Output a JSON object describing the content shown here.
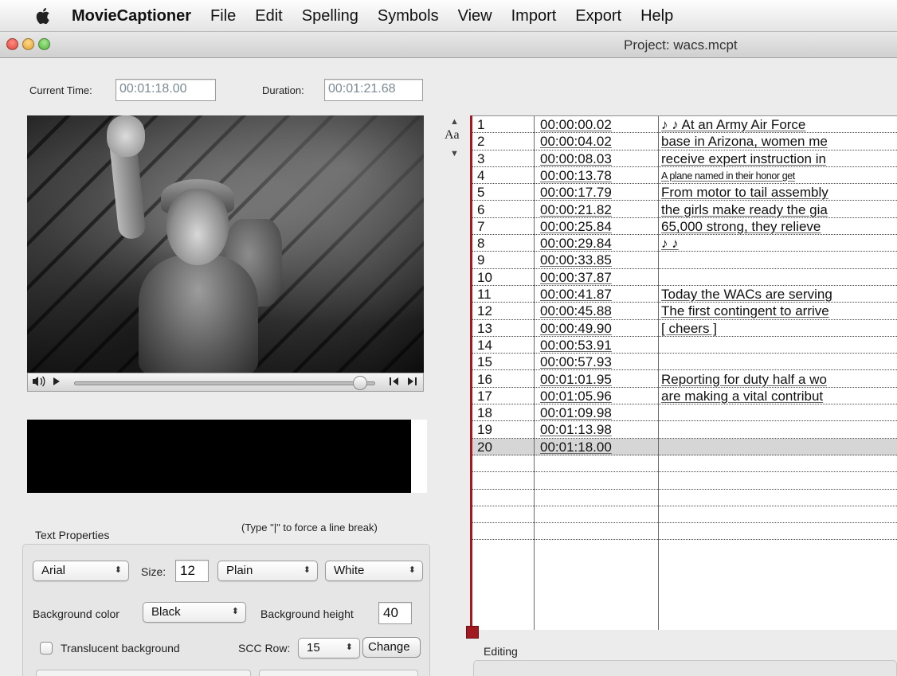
{
  "menubar": {
    "app_name": "MovieCaptioner",
    "items": [
      "File",
      "Edit",
      "Spelling",
      "Symbols",
      "View",
      "Import",
      "Export",
      "Help"
    ]
  },
  "window": {
    "title": "Project: wacs.mcpt"
  },
  "time": {
    "current_label": "Current Time:",
    "current_value": "00:01:18.00",
    "duration_label": "Duration:",
    "duration_value": "00:01:21.68"
  },
  "player": {
    "volume_icon": "speaker-icon",
    "play_icon": "play-icon",
    "position_fraction": 0.95
  },
  "sort": {
    "label": "Aa"
  },
  "captions": [
    {
      "num": "1",
      "time": "00:00:00.02",
      "text": "♪ ♪ At an Army Air Force"
    },
    {
      "num": "2",
      "time": "00:00:04.02",
      "text": "base in Arizona, women me"
    },
    {
      "num": "3",
      "time": "00:00:08.03",
      "text": "receive expert instruction in"
    },
    {
      "num": "4",
      "time": "00:00:13.78",
      "text": "A plane named in their honor get"
    },
    {
      "num": "5",
      "time": "00:00:17.79",
      "text": "From motor to tail assembly"
    },
    {
      "num": "6",
      "time": "00:00:21.82",
      "text": "the girls make ready the gia"
    },
    {
      "num": "7",
      "time": "00:00:25.84",
      "text": "65,000 strong, they relieve"
    },
    {
      "num": "8",
      "time": "00:00:29.84",
      "text": "♪ ♪"
    },
    {
      "num": "9",
      "time": "00:00:33.85",
      "text": ""
    },
    {
      "num": "10",
      "time": "00:00:37.87",
      "text": ""
    },
    {
      "num": "11",
      "time": "00:00:41.87",
      "text": "Today the WACs are serving"
    },
    {
      "num": "12",
      "time": "00:00:45.88",
      "text": "The first contingent to arrive"
    },
    {
      "num": "13",
      "time": "00:00:49.90",
      "text": "[ cheers ]"
    },
    {
      "num": "14",
      "time": "00:00:53.91",
      "text": ""
    },
    {
      "num": "15",
      "time": "00:00:57.93",
      "text": ""
    },
    {
      "num": "16",
      "time": "00:01:01.95",
      "text": "Reporting for duty half a wo"
    },
    {
      "num": "17",
      "time": "00:01:05.96",
      "text": "are making a vital contribut"
    },
    {
      "num": "18",
      "time": "00:01:09.98",
      "text": ""
    },
    {
      "num": "19",
      "time": "00:01:13.98",
      "text": ""
    },
    {
      "num": "20",
      "time": "00:01:18.00",
      "text": ""
    }
  ],
  "text_properties": {
    "title": "Text Properties",
    "hint": "(Type  \"|\" to force a line break)",
    "font": "Arial",
    "size_label": "Size:",
    "size_value": "12",
    "style": "Plain",
    "color": "White",
    "bg_color_label": "Background color",
    "bg_color": "Black",
    "bg_height_label": "Background height",
    "bg_height": "40",
    "translucent_label": "Translucent background",
    "scc_row_label": "SCC Row:",
    "scc_row": "15",
    "change_label": "Change"
  },
  "editing": {
    "label": "Editing"
  },
  "colors": {
    "selected_row": "#d6d6d6",
    "marker_red": "#a11a22"
  }
}
